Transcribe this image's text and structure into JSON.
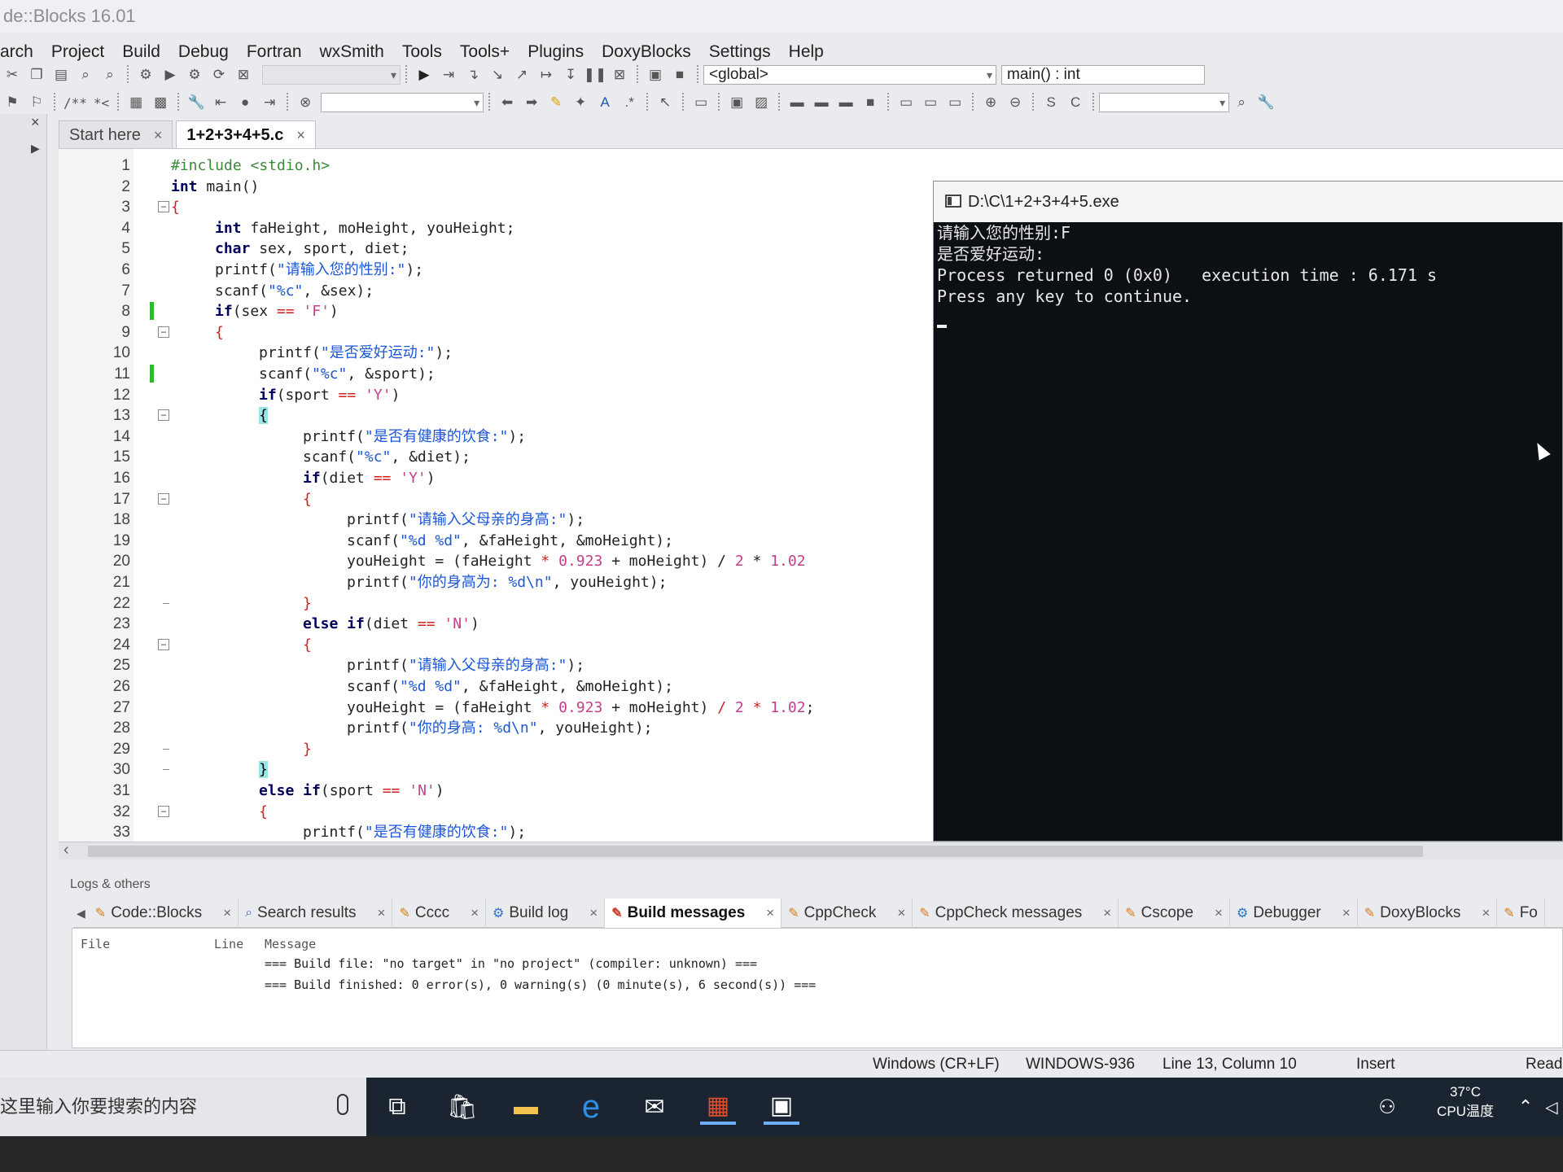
{
  "window": {
    "title": "de::Blocks 16.01"
  },
  "menu": [
    "arch",
    "Project",
    "Build",
    "Debug",
    "Fortran",
    "wxSmith",
    "Tools",
    "Tools+",
    "Plugins",
    "DoxyBlocks",
    "Settings",
    "Help"
  ],
  "toolbar": {
    "scope_combo": "<global>",
    "function_combo": "main() : int",
    "comment_btn": "/**",
    "stream_btn": "*<"
  },
  "editor": {
    "tabs": [
      {
        "label": "Start here",
        "close": "×"
      },
      {
        "label": "1+2+3+4+5.c",
        "close": "×"
      }
    ],
    "line_numbers": [
      "1",
      "2",
      "3",
      "4",
      "5",
      "6",
      "7",
      "8",
      "9",
      "10",
      "11",
      "12",
      "13",
      "14",
      "15",
      "16",
      "17",
      "18",
      "19",
      "20",
      "21",
      "22",
      "23",
      "24",
      "25",
      "26",
      "27",
      "28",
      "29",
      "30",
      "31",
      "32",
      "33"
    ],
    "lines": {
      "l1": "#include <stdio.h>",
      "l2a": "int",
      "l2b": " main()",
      "l3": "{",
      "l4a": "int",
      "l4b": " faHeight, moHeight, youHeight;",
      "l5a": "char",
      "l5b": " sex, sport, diet;",
      "l6a": "printf(",
      "l6b": "\"请输入您的性别:\"",
      "l6c": ");",
      "l7a": "scanf(",
      "l7b": "\"%c\"",
      "l7c": ", &sex);",
      "l8a": "if",
      "l8b": "(sex ",
      "l8c": "==",
      "l8d": " ",
      "l8e": "'F'",
      "l8f": ")",
      "l9": "{",
      "l10a": "printf(",
      "l10b": "\"是否爱好运动:\"",
      "l10c": ");",
      "l11a": "scanf(",
      "l11b": "\"%c\"",
      "l11c": ", &sport);",
      "l12a": "if",
      "l12b": "(sport ",
      "l12c": "==",
      "l12d": " ",
      "l12e": "'Y'",
      "l12f": ")",
      "l13": "{",
      "l14a": "printf(",
      "l14b": "\"是否有健康的饮食:\"",
      "l14c": ");",
      "l15a": "scanf(",
      "l15b": "\"%c\"",
      "l15c": ", &diet);",
      "l16a": "if",
      "l16b": "(diet ",
      "l16c": "==",
      "l16d": " ",
      "l16e": "'Y'",
      "l16f": ")",
      "l17": "{",
      "l18a": "printf(",
      "l18b": "\"请输入父母亲的身高:\"",
      "l18c": ");",
      "l19a": "scanf(",
      "l19b": "\"%d %d\"",
      "l19c": ", &faHeight, &moHeight);",
      "l20a": "youHeight = (faHeight ",
      "l20b": "*",
      "l20c": " ",
      "l20d": "0.923",
      "l20e": " + moHeight) / ",
      "l20f": "2",
      "l20g": " * ",
      "l20h": "1.02",
      "l21a": "printf(",
      "l21b": "\"你的身高为: %d\\n\"",
      "l21c": ", youHeight);",
      "l22": "}",
      "l23a": "else if",
      "l23b": "(diet ",
      "l23c": "==",
      "l23d": " ",
      "l23e": "'N'",
      "l23f": ")",
      "l24": "{",
      "l25a": "printf(",
      "l25b": "\"请输入父母亲的身高:\"",
      "l25c": ");",
      "l26a": "scanf(",
      "l26b": "\"%d %d\"",
      "l26c": ", &faHeight, &moHeight);",
      "l27a": "youHeight = (faHeight ",
      "l27b": "*",
      "l27c": " ",
      "l27d": "0.923",
      "l27e": " + moHeight) ",
      "l27f": "/",
      "l27g": " ",
      "l27h": "2",
      "l27i": " ",
      "l27j": "*",
      "l27k": " ",
      "l27l": "1.02",
      "l27m": ";",
      "l28a": "printf(",
      "l28b": "\"你的身高: %d\\n\"",
      "l28c": ", youHeight);",
      "l29": "}",
      "l30": "}",
      "l31a": "else if",
      "l31b": "(sport ",
      "l31c": "==",
      "l31d": " ",
      "l31e": "'N'",
      "l31f": ")",
      "l32": "{",
      "l33a": "printf(",
      "l33b": "\"是否有健康的饮食:\"",
      "l33c": ");"
    }
  },
  "console": {
    "title": "D:\\C\\1+2+3+4+5.exe",
    "line1": "请输入您的性别:F",
    "line2": "是否爱好运动:",
    "line3": "Process returned 0 (0x0)   execution time : 6.171 s",
    "line4": "Press any key to continue."
  },
  "logs": {
    "title": "Logs & others",
    "tabs": [
      {
        "label": "Code::Blocks",
        "close": "×"
      },
      {
        "label": "Search results",
        "close": "×"
      },
      {
        "label": "Cccc",
        "close": "×"
      },
      {
        "label": "Build log",
        "close": "×"
      },
      {
        "label": "Build messages",
        "close": "×"
      },
      {
        "label": "CppCheck",
        "close": "×"
      },
      {
        "label": "CppCheck messages",
        "close": "×"
      },
      {
        "label": "Cscope",
        "close": "×"
      },
      {
        "label": "Debugger",
        "close": "×"
      },
      {
        "label": "DoxyBlocks",
        "close": "×"
      },
      {
        "label": "Fo",
        "close": ""
      }
    ],
    "columns": {
      "file": "File",
      "line": "Line",
      "message": "Message"
    },
    "rows": [
      "=== Build file: \"no target\" in \"no project\" (compiler: unknown) ===",
      "=== Build finished: 0 error(s), 0 warning(s) (0 minute(s), 6 second(s)) ==="
    ]
  },
  "status": {
    "eol": "Windows (CR+LF)",
    "encoding": "WINDOWS-936",
    "position": "Line 13, Column 10",
    "mode": "Insert",
    "rw": "Read"
  },
  "taskbar": {
    "search_placeholder": "这里输入你要搜索的内容",
    "temp": "37°C",
    "temp_label": "CPU温度"
  }
}
